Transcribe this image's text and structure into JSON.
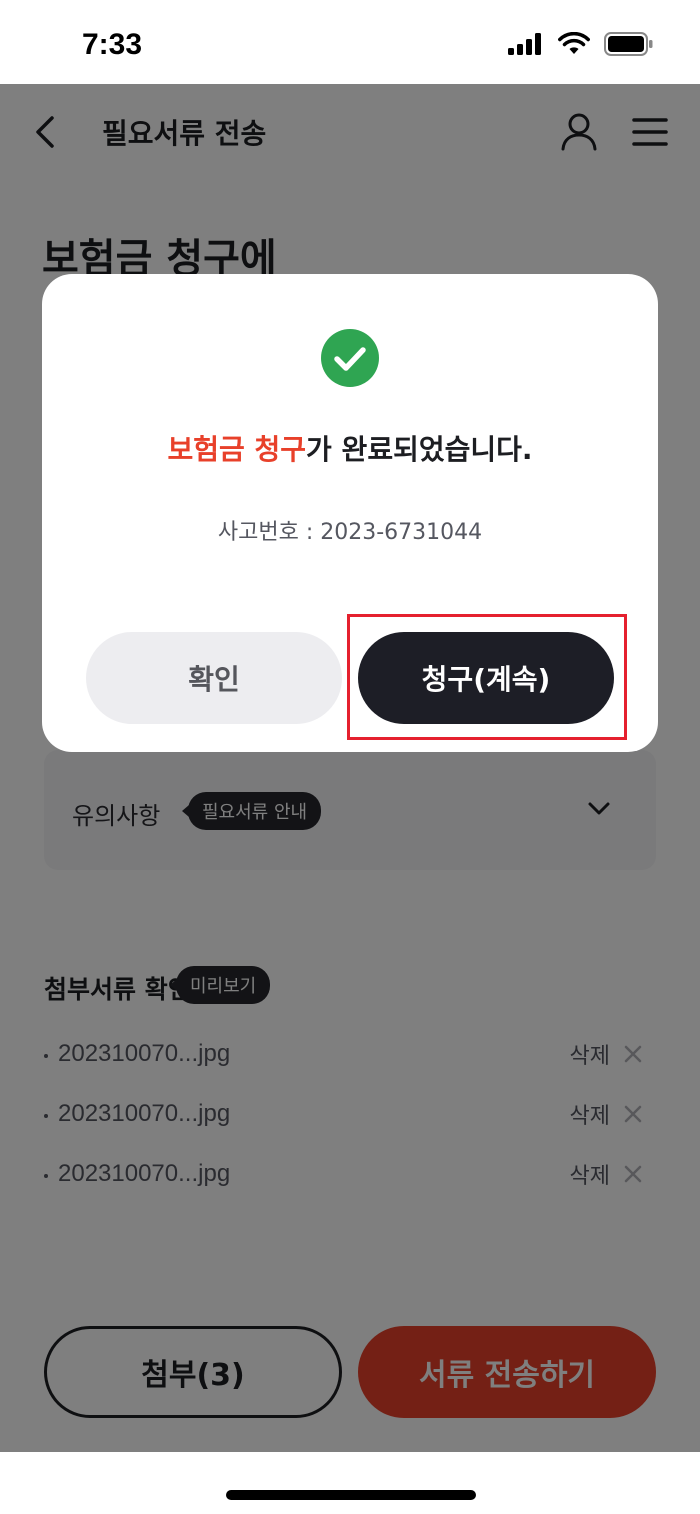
{
  "status_bar": {
    "time": "7:33"
  },
  "header": {
    "title": "필요서류 전송"
  },
  "page": {
    "headline": "보험금 청구에"
  },
  "notice": {
    "label": "유의사항",
    "tag": "필요서류 안내"
  },
  "attachments": {
    "title": "첨부서류 확인",
    "preview_tag": "미리보기",
    "delete_label": "삭제",
    "files": [
      "202310070...jpg",
      "202310070...jpg",
      "202310070...jpg"
    ]
  },
  "bottom": {
    "attach_label": "첨부(3)",
    "send_label": "서류 전송하기"
  },
  "modal": {
    "message_accent": "보험금 청구",
    "message_rest": "가 완료되었습니다.",
    "accident_label": "사고번호 : ",
    "accident_number": "2023-6731044",
    "confirm_label": "확인",
    "continue_label": "청구(계속)"
  },
  "colors": {
    "accent": "#e8402a",
    "success": "#2fa552",
    "primary_dark": "#1d1e26",
    "highlight": "#e5202e"
  },
  "icons": [
    "signal-icon",
    "wifi-icon",
    "battery-icon",
    "back-chevron-icon",
    "user-icon",
    "menu-icon",
    "chevron-down-icon",
    "close-icon",
    "check-circle-icon"
  ]
}
